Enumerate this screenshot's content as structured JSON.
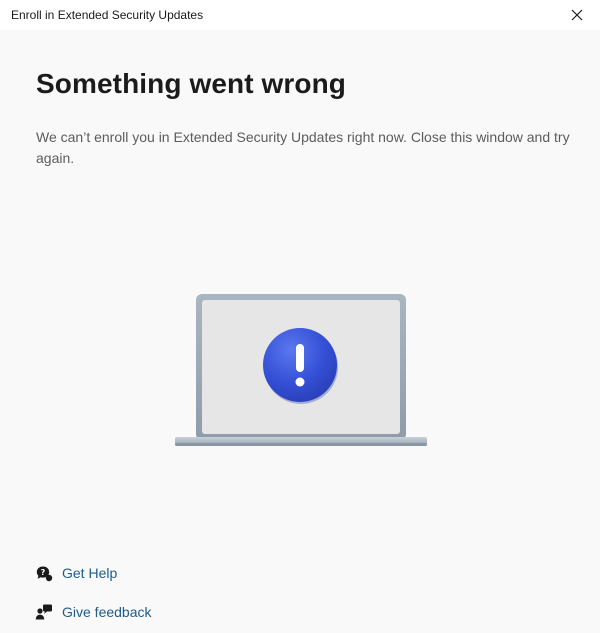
{
  "window": {
    "title": "Enroll in Extended Security Updates"
  },
  "main": {
    "heading": "Something went wrong",
    "message": "We can’t enroll you in Extended Security Updates right now. Close this window and try again.",
    "illustration_icon": "laptop-error-icon"
  },
  "links": {
    "help": {
      "label": "Get Help",
      "icon": "help-chat-icon"
    },
    "feedback": {
      "label": "Give feedback",
      "icon": "feedback-person-icon"
    }
  },
  "colors": {
    "link": "#1f5b8a",
    "error_badge": "#3c55d8",
    "heading": "#1b1b1b",
    "body_text": "#5c5c5c"
  }
}
